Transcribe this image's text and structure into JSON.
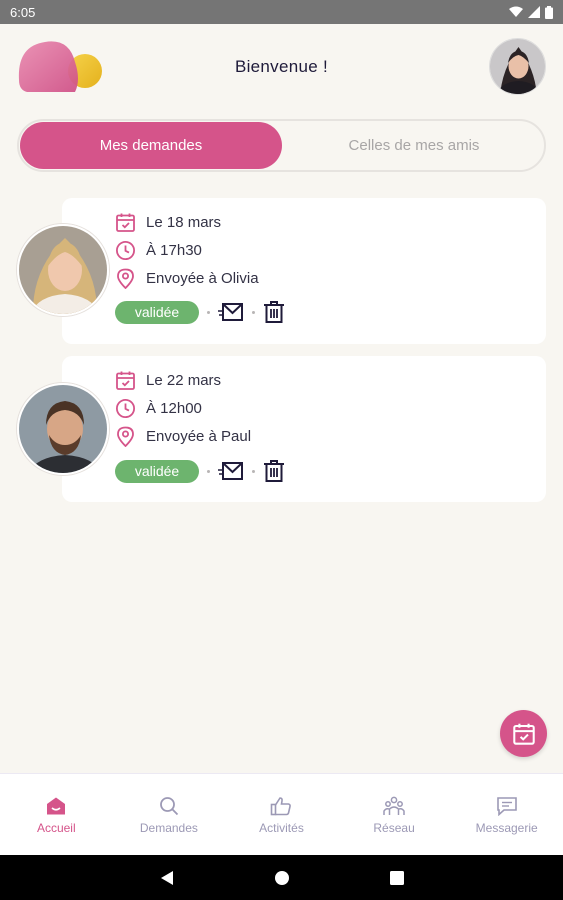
{
  "status_bar": {
    "time": "6:05"
  },
  "header": {
    "title": "Bienvenue !"
  },
  "tabs": {
    "active_label": "Mes demandes",
    "inactive_label": "Celles de mes amis"
  },
  "requests": [
    {
      "date": "Le 18 mars",
      "time": "À 17h30",
      "recipient": "Envoyée à Olivia",
      "status": "validée"
    },
    {
      "date": "Le 22 mars",
      "time": "À 12h00",
      "recipient": "Envoyée à Paul",
      "status": "validée"
    }
  ],
  "nav": [
    {
      "label": "Accueil",
      "icon": "home-icon",
      "active": true
    },
    {
      "label": "Demandes",
      "icon": "search-icon",
      "active": false
    },
    {
      "label": "Activités",
      "icon": "thumbs-up-icon",
      "active": false
    },
    {
      "label": "Réseau",
      "icon": "network-icon",
      "active": false
    },
    {
      "label": "Messagerie",
      "icon": "chat-icon",
      "active": false
    }
  ],
  "colors": {
    "accent": "#d5548a",
    "success": "#6db46e",
    "background": "#f8f6f1",
    "nav_inactive": "#9c99b5"
  }
}
